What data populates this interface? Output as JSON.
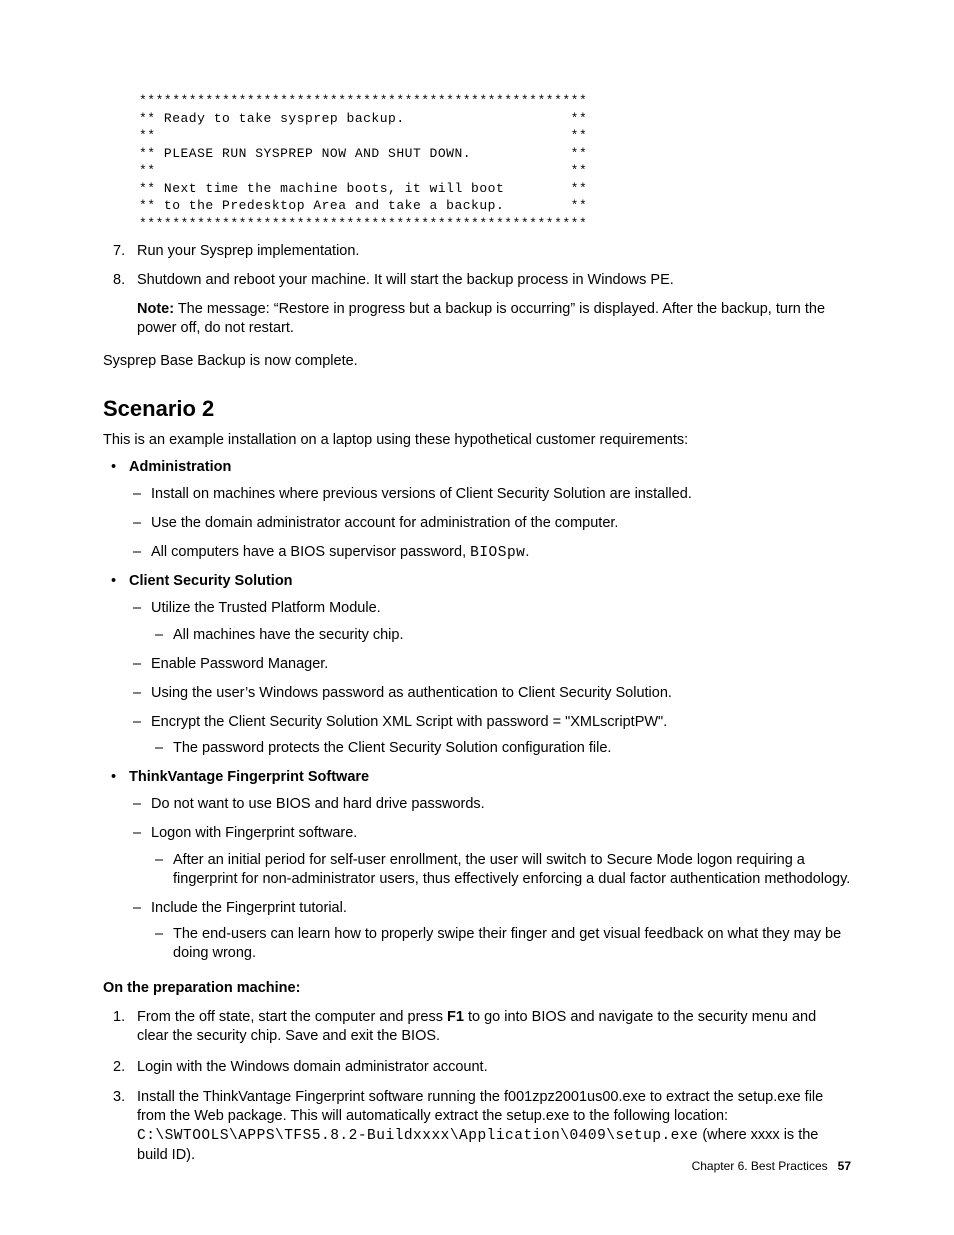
{
  "code_block": "******************************************************\n** Ready to take sysprep backup.                    **\n**                                                  **\n** PLEASE RUN SYSPREP NOW AND SHUT DOWN.            **\n**                                                  **\n** Next time the machine boots, it will boot        **\n** to the Predesktop Area and take a backup.        **\n******************************************************",
  "step7_num": "7.",
  "step7": "Run your Sysprep implementation.",
  "step8_num": "8.",
  "step8": "Shutdown and reboot your machine. It will start the backup process in Windows PE.",
  "note_label": "Note:",
  "note_text": " The message: “Restore in progress but a backup is occurring” is displayed. After the backup, turn the power off, do not restart.",
  "complete_line": "Sysprep Base Backup is now complete.",
  "scenario_heading": "Scenario 2",
  "intro": "This is an example installation on a laptop using these hypothetical customer requirements:",
  "b1_head": "Administration",
  "b1_a": "Install on machines where previous versions of Client Security Solution are installed.",
  "b1_b": "Use the domain administrator account for administration of the computer.",
  "b1_c_pre": "All computers have a BIOS supervisor password, ",
  "b1_c_code": "BIOSpw",
  "b1_c_post": ".",
  "b2_head": "Client Security Solution",
  "b2_a": "Utilize the Trusted Platform Module.",
  "b2_a_1": "All machines have the security chip.",
  "b2_b": "Enable Password Manager.",
  "b2_c": "Using the user’s Windows password as authentication to Client Security Solution.",
  "b2_d": "Encrypt the Client Security Solution XML Script with password = \"XMLscriptPW\".",
  "b2_d_1": "The password protects the Client Security Solution configuration file.",
  "b3_head": "ThinkVantage Fingerprint Software",
  "b3_a": "Do not want to use BIOS and hard drive passwords.",
  "b3_b": "Logon with Fingerprint software.",
  "b3_b_1": "After an initial period for self-user enrollment, the user will switch to Secure Mode logon requiring a fingerprint for non-administrator users, thus effectively enforcing a dual factor authentication methodology.",
  "b3_c": "Include the Fingerprint tutorial.",
  "b3_c_1": "The end-users can learn how to properly swipe their finger and get visual feedback on what they may be doing wrong.",
  "prep_heading": "On the preparation machine:",
  "p1_num": "1.",
  "p1_a": "From the off state, start the computer and press ",
  "p1_f1": "F1",
  "p1_b": " to go into BIOS and navigate to the security menu and clear the security chip. Save and exit the BIOS.",
  "p2_num": "2.",
  "p2": "Login with the Windows domain administrator account.",
  "p3_num": "3.",
  "p3_a": " Install the ThinkVantage Fingerprint software running the f001zpz2001us00.exe to extract the setup.exe file from the Web package. This will automatically extract the setup.exe to the following location: ",
  "p3_code": "C:\\SWTOOLS\\APPS\\TFS5.8.2-Buildxxxx\\Application\\0409\\setup.exe",
  "p3_b": " (where xxxx is the build ID).",
  "footer_chapter": "Chapter 6. Best Practices",
  "footer_page": "57"
}
